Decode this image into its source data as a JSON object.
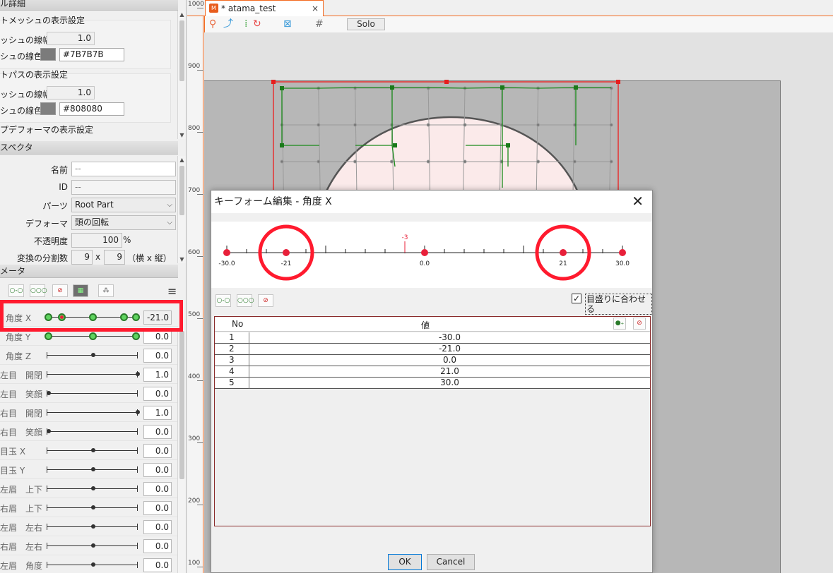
{
  "left_panel": {
    "display_section_title": "ル詳細",
    "art_mesh_display_title": "トメッシュの表示設定",
    "art_mesh_line_width_label": "ッシュの線幅",
    "art_mesh_line_width_value": "1.0",
    "art_mesh_line_color_label": "シュの線色",
    "art_mesh_line_color_hex": "#7B7B7B",
    "art_path_display_title": "トパスの表示設定",
    "art_path_line_width_label": "ッシュの線幅",
    "art_path_line_width_value": "1.0",
    "art_path_line_color_label": "シュの線色",
    "art_path_line_color_hex": "#808080",
    "deformer_display_title": "プデフォーマの表示設定",
    "inspector_title": "スペクタ",
    "inspector": {
      "name_label": "名前",
      "name_value": "--",
      "id_label": "ID",
      "id_value": "--",
      "parts_label": "パーツ",
      "parts_value": "Root Part",
      "deformer_label": "デフォーマ",
      "deformer_value": "頭の回転",
      "opacity_label": "不透明度",
      "opacity_value": "100",
      "opacity_unit": "%",
      "divisions_label": "変換の分割数",
      "div_x": "9",
      "div_times": "x",
      "div_y": "9",
      "div_hint": "（横 x 縦）"
    },
    "parameters_title": "メータ",
    "parameters": [
      {
        "name": "角度 X",
        "value": "-21.0"
      },
      {
        "name": "角度 Y",
        "value": "0.0"
      },
      {
        "name": "角度 Z",
        "value": "0.0"
      },
      {
        "name": "左目　開閉",
        "value": "1.0"
      },
      {
        "name": "左目　笑顔",
        "value": "0.0"
      },
      {
        "name": "右目　開閉",
        "value": "1.0"
      },
      {
        "name": "右目　笑顔",
        "value": "0.0"
      },
      {
        "name": "目玉 X",
        "value": "0.0"
      },
      {
        "name": "目玉 Y",
        "value": "0.0"
      },
      {
        "name": "左眉　上下",
        "value": "0.0"
      },
      {
        "name": "右眉　上下",
        "value": "0.0"
      },
      {
        "name": "左眉　左右",
        "value": "0.0"
      },
      {
        "name": "右眉　左右",
        "value": "0.0"
      },
      {
        "name": "左眉　角度",
        "value": "0.0"
      }
    ]
  },
  "canvas": {
    "tab_title": "* atama_test",
    "tab_close": "×",
    "solo_label": "Solo",
    "ruler_labels": [
      "1000",
      "900",
      "800",
      "700",
      "600",
      "500",
      "400",
      "300",
      "200",
      "100"
    ]
  },
  "dialog": {
    "title": "キーフォーム編集 - 角度 X",
    "close": "✕",
    "current_value_marker": "-3",
    "keyforms": [
      "-30.0",
      "-21",
      "0.0",
      "21",
      "30.0"
    ],
    "snap_label": "目盛りに合わせる",
    "table_headers": {
      "no": "No",
      "value": "値"
    },
    "rows": [
      {
        "no": "1",
        "value": "-30.0"
      },
      {
        "no": "2",
        "value": "-21.0"
      },
      {
        "no": "3",
        "value": "0.0"
      },
      {
        "no": "4",
        "value": "21.0"
      },
      {
        "no": "5",
        "value": "30.0"
      }
    ],
    "ok": "OK",
    "cancel": "Cancel"
  },
  "colors": {
    "accent_orange": "#f36b21",
    "highlight_red": "#ff1a2e",
    "keyform_red": "#e8203a",
    "node_green": "#5fd35f"
  }
}
